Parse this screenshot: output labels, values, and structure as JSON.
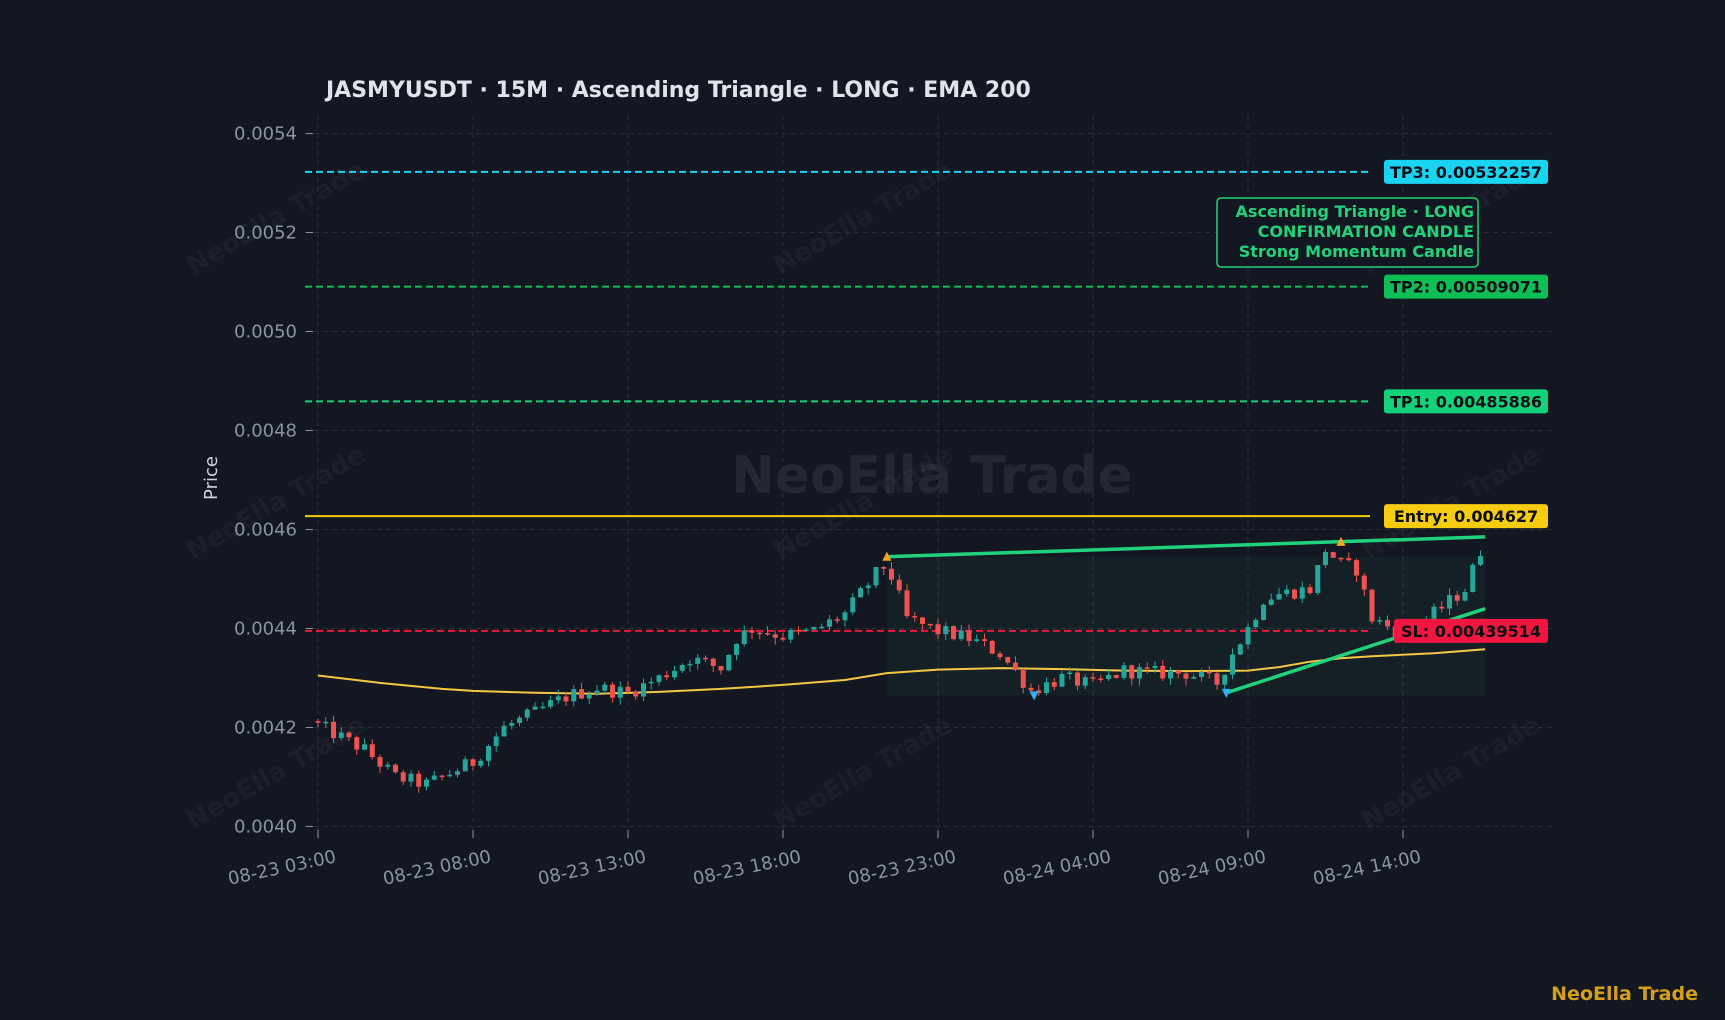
{
  "brand": {
    "watermark": "NeoElla Trade",
    "footer": "NeoElla Trade"
  },
  "chart_data": {
    "type": "candlestick",
    "title": "JASMYUSDT  ·  15M  ·  Ascending Triangle  ·  LONG  ·  EMA 200",
    "symbol": "JASMYUSDT",
    "timeframe": "15M",
    "pattern": "Ascending Triangle",
    "direction": "LONG",
    "indicator": "EMA 200",
    "xlabel": "",
    "ylabel": "Price",
    "ylim": [
      0.00398,
      0.00546
    ],
    "y_ticks": [
      "0.0040",
      "0.0042",
      "0.0044",
      "0.0046",
      "0.0048",
      "0.0050",
      "0.0052",
      "0.0054"
    ],
    "x_ticks": [
      "08-23 03:00",
      "08-23 08:00",
      "08-23 13:00",
      "08-23 18:00",
      "08-23 23:00",
      "08-24 04:00",
      "08-24 09:00",
      "08-24 14:00"
    ],
    "x_range_hours": [
      -0.5,
      39.5
    ],
    "grid": true,
    "colors": {
      "bg": "#131722",
      "up": "#26a69a",
      "down": "#ef5350",
      "grid": "#2a2e39",
      "ema": "#f2c744",
      "pattern": "#22d27a"
    },
    "levels": [
      {
        "name": "TP3",
        "value": 0.00532257,
        "label": "TP3: 0.00532257",
        "color": "#18d4f0",
        "style": "dashed"
      },
      {
        "name": "TP2",
        "value": 0.00509071,
        "label": "TP2: 0.00509071",
        "color": "#0fbf56",
        "style": "dashed"
      },
      {
        "name": "TP1",
        "value": 0.00485886,
        "label": "TP1: 0.00485886",
        "color": "#14d27a",
        "style": "dashed"
      },
      {
        "name": "Entry",
        "value": 0.004627,
        "label": "Entry: 0.004627",
        "color": "#f5cc0f",
        "style": "solid"
      },
      {
        "name": "SL",
        "value": 0.00439514,
        "label": "SL: 0.00439514",
        "color": "#f0163f",
        "style": "dashed"
      }
    ],
    "annotation": [
      "Ascending Triangle · LONG",
      "CONFIRMATION CANDLE",
      "Strong Momentum Candle"
    ],
    "pattern_lines": {
      "resistance": [
        [
          18.35,
          0.004545
        ],
        [
          37.65,
          0.004585
        ]
      ],
      "support": [
        [
          29.3,
          0.00427
        ],
        [
          37.65,
          0.00444
        ]
      ],
      "zone_start": 18.35
    },
    "markers": [
      {
        "t": 18.35,
        "price": 0.004545,
        "dir": "up",
        "color": "#f5a623"
      },
      {
        "t": 23.1,
        "price": 0.004265,
        "dir": "down",
        "color": "#29b6f6"
      },
      {
        "t": 29.3,
        "price": 0.00427,
        "dir": "down",
        "color": "#29b6f6"
      },
      {
        "t": 33.0,
        "price": 0.004575,
        "dir": "up",
        "color": "#f5a623"
      }
    ],
    "ema": [
      [
        0,
        0.004305
      ],
      [
        2,
        0.00429
      ],
      [
        4,
        0.004278
      ],
      [
        5,
        0.004274
      ],
      [
        7,
        0.00427
      ],
      [
        9,
        0.004268
      ],
      [
        11,
        0.004272
      ],
      [
        13,
        0.004278
      ],
      [
        15,
        0.004286
      ],
      [
        17,
        0.004296
      ],
      [
        18.35,
        0.00431
      ],
      [
        20,
        0.004317
      ],
      [
        22,
        0.00432
      ],
      [
        24,
        0.004318
      ],
      [
        26,
        0.004315
      ],
      [
        28,
        0.004314
      ],
      [
        30,
        0.004315
      ],
      [
        31,
        0.004322
      ],
      [
        32,
        0.004333
      ],
      [
        33,
        0.00434
      ],
      [
        34,
        0.004344
      ],
      [
        36,
        0.00435
      ],
      [
        37.65,
        0.004358
      ]
    ],
    "ohlc_anchors": [
      [
        0,
        0.004205
      ],
      [
        1.5,
        0.004155
      ],
      [
        2.5,
        0.0041
      ],
      [
        3.5,
        0.004085
      ],
      [
        4.5,
        0.004115
      ],
      [
        5,
        0.00413
      ],
      [
        6,
        0.0042
      ],
      [
        7,
        0.00423
      ],
      [
        8,
        0.004262
      ],
      [
        9,
        0.00428
      ],
      [
        10,
        0.00427
      ],
      [
        11,
        0.0043
      ],
      [
        12,
        0.00434
      ],
      [
        13,
        0.00432
      ],
      [
        13.5,
        0.00438
      ],
      [
        14,
        0.0044
      ],
      [
        15,
        0.004385
      ],
      [
        16,
        0.004395
      ],
      [
        17,
        0.00443
      ],
      [
        18,
        0.00451
      ],
      [
        18.35,
        0.00453
      ],
      [
        19,
        0.00442
      ],
      [
        20,
        0.004395
      ],
      [
        21,
        0.00438
      ],
      [
        22,
        0.00435
      ],
      [
        23,
        0.004275
      ],
      [
        24,
        0.0043
      ],
      [
        25,
        0.004285
      ],
      [
        26,
        0.004315
      ],
      [
        27,
        0.00431
      ],
      [
        28,
        0.00431
      ],
      [
        29,
        0.00429
      ],
      [
        29.5,
        0.00435
      ],
      [
        30,
        0.0044
      ],
      [
        30.5,
        0.00446
      ],
      [
        31,
        0.00447
      ],
      [
        32,
        0.00448
      ],
      [
        32.5,
        0.00456
      ],
      [
        33,
        0.00453
      ],
      [
        33.5,
        0.00452
      ],
      [
        34,
        0.00442
      ],
      [
        35,
        0.00439
      ],
      [
        36,
        0.00443
      ],
      [
        37,
        0.00448
      ],
      [
        37.65,
        0.00458
      ]
    ]
  }
}
